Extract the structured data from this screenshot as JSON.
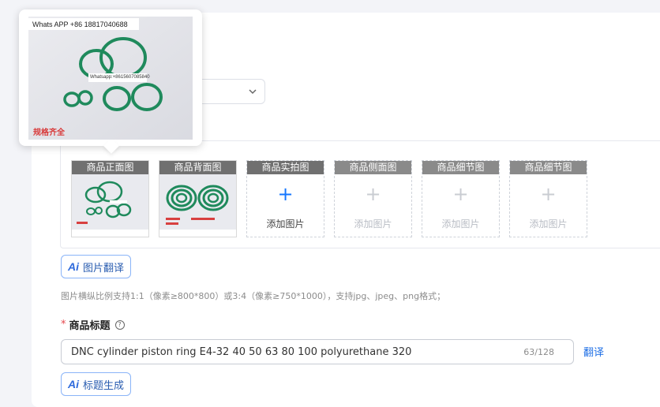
{
  "image_slots": [
    {
      "label": "商品正面图",
      "state": "filled"
    },
    {
      "label": "商品背面图",
      "state": "filled"
    },
    {
      "label": "商品实拍图",
      "state": "empty",
      "add_label": "添加图片"
    },
    {
      "label": "商品侧面图",
      "state": "disabled",
      "add_label": "添加图片"
    },
    {
      "label": "商品细节图",
      "state": "disabled",
      "add_label": "添加图片"
    },
    {
      "label": "商品细节图",
      "state": "disabled",
      "add_label": "添加图片"
    }
  ],
  "image_translate_button": {
    "icon": "ai-icon",
    "label": "图片翻译"
  },
  "image_hint": "图片横纵比例支持1:1（像素≥800*800）或3:4（像素≥750*1000），支持jpg、jpeg、png格式；",
  "title_field": {
    "required_mark": "*",
    "label": "商品标题",
    "help_icon": "?",
    "value": "DNC cylinder piston ring E4-32 40 50 63 80 100 polyurethane 320",
    "counter": "63/128",
    "translate_label": "翻译"
  },
  "title_generate_button": {
    "icon": "ai-icon",
    "label": "标题生成"
  },
  "preview_popover": {
    "watermark_top": "Whats APP +86 18817040688",
    "watermark_mid": "Whatsapp:+8615607085840",
    "caption": "规格齐全"
  },
  "colors": {
    "accent": "#1677ff",
    "ring_green": "#1f8a5c",
    "slot_header": "#707070",
    "required": "#e5484d"
  }
}
